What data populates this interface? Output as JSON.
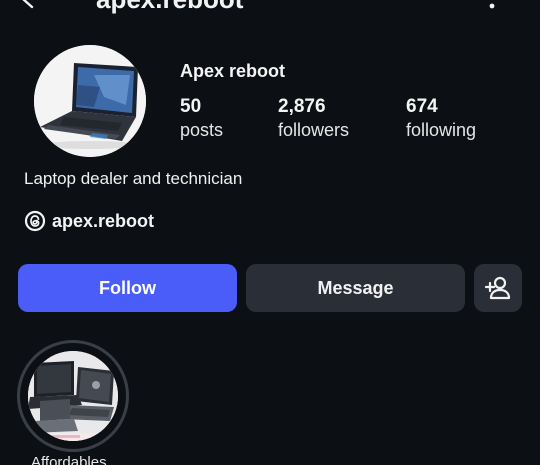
{
  "header": {
    "handle": "apex.reboot",
    "back_icon": "arrow-left-icon",
    "more_icon": "more-vertical-icon"
  },
  "profile": {
    "display_name": "Apex reboot",
    "avatar_icon": "laptop-photo",
    "stats": {
      "posts": {
        "value": "50",
        "label": "posts"
      },
      "followers": {
        "value": "2,876",
        "label": "followers"
      },
      "following": {
        "value": "674",
        "label": "following"
      }
    },
    "bio": "Laptop dealer and technician",
    "threads": {
      "icon": "threads-icon",
      "handle": "apex.reboot"
    }
  },
  "actions": {
    "follow_label": "Follow",
    "message_label": "Message",
    "add_user_icon": "person-add-icon"
  },
  "highlights": [
    {
      "label": "Affordables"
    }
  ],
  "colors": {
    "background": "#0c0f14",
    "follow_button": "#4a5df9",
    "secondary_button": "#2a2e37",
    "text": "#f4f4f4"
  }
}
